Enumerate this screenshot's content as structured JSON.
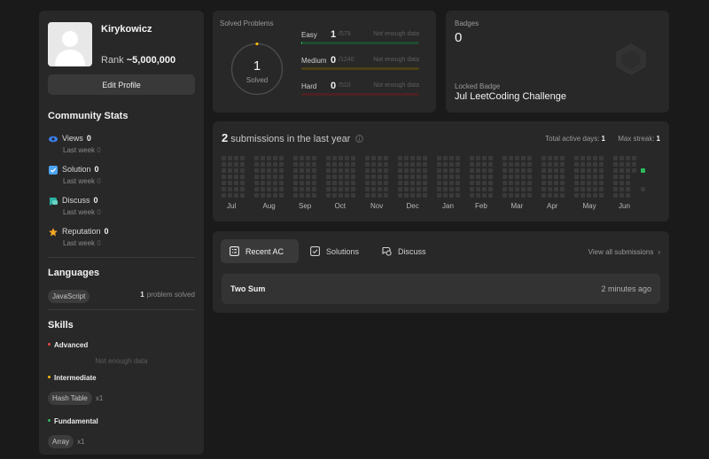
{
  "profile": {
    "username": "Kirykowicz",
    "rank_label": "Rank",
    "rank_value": "~5,000,000",
    "edit_label": "Edit Profile"
  },
  "community": {
    "title": "Community Stats",
    "stats": [
      {
        "label": "Views",
        "value": "0",
        "sub_label": "Last week",
        "sub_value": "0",
        "icon": "eye-icon",
        "color": "#3b82f6"
      },
      {
        "label": "Solution",
        "value": "0",
        "sub_label": "Last week",
        "sub_value": "0",
        "icon": "check-square-icon",
        "color": "#4da3f5"
      },
      {
        "label": "Discuss",
        "value": "0",
        "sub_label": "Last week",
        "sub_value": "0",
        "icon": "chat-icon",
        "color": "#2eb3a5"
      },
      {
        "label": "Reputation",
        "value": "0",
        "sub_label": "Last week",
        "sub_value": "0",
        "icon": "star-icon",
        "color": "#f5a623"
      }
    ]
  },
  "languages": {
    "title": "Languages",
    "items": [
      {
        "name": "JavaScript",
        "count": "1",
        "suffix": "problem solved"
      }
    ]
  },
  "skills": {
    "title": "Skills",
    "groups": [
      {
        "level": "Advanced",
        "dot_color": "#ef4743",
        "empty_note": "Not enough data",
        "tags": []
      },
      {
        "level": "Intermediate",
        "dot_color": "#ffb700",
        "tags": [
          {
            "name": "Hash Table",
            "count": "x1"
          }
        ]
      },
      {
        "level": "Fundamental",
        "dot_color": "#2cbb5d",
        "tags": [
          {
            "name": "Array",
            "count": "x1"
          }
        ]
      }
    ]
  },
  "solved": {
    "title": "Solved Problems",
    "total": "1",
    "total_label": "Solved",
    "difficulties": [
      {
        "name": "Easy",
        "solved": "1",
        "total": "/579",
        "note": "Not enough data",
        "color": "#2cbb5d",
        "track": "#1e4a2e",
        "fraction": 0.0017
      },
      {
        "name": "Medium",
        "solved": "0",
        "total": "/1240",
        "note": "Not enough data",
        "color": "#ffb700",
        "track": "#4d3f16",
        "fraction": 0
      },
      {
        "name": "Hard",
        "solved": "0",
        "total": "/510",
        "note": "Not enough data",
        "color": "#ef4743",
        "track": "#4a2221",
        "fraction": 0
      }
    ]
  },
  "badges": {
    "title": "Badges",
    "count": "0",
    "locked_label": "Locked Badge",
    "locked_name": "Jul LeetCoding Challenge"
  },
  "calendar": {
    "count": "2",
    "title_rest": "submissions in the last year",
    "active_label": "Total active days:",
    "active_value": "1",
    "streak_label": "Max streak:",
    "streak_value": "1",
    "months": [
      "Jul",
      "Aug",
      "Sep",
      "Oct",
      "Nov",
      "Dec",
      "Jan",
      "Feb",
      "Mar",
      "Apr",
      "May",
      "Jun"
    ],
    "empty_color": "#3a3a3a",
    "active_color": "#2cbb5d"
  },
  "recent": {
    "tabs": [
      {
        "label": "Recent AC",
        "icon": "list-icon",
        "active": true
      },
      {
        "label": "Solutions",
        "icon": "check-square-icon",
        "active": false
      },
      {
        "label": "Discuss",
        "icon": "chat-icon",
        "active": false
      }
    ],
    "view_all": "View all submissions",
    "submissions": [
      {
        "title": "Two Sum",
        "time": "2 minutes ago"
      }
    ]
  }
}
